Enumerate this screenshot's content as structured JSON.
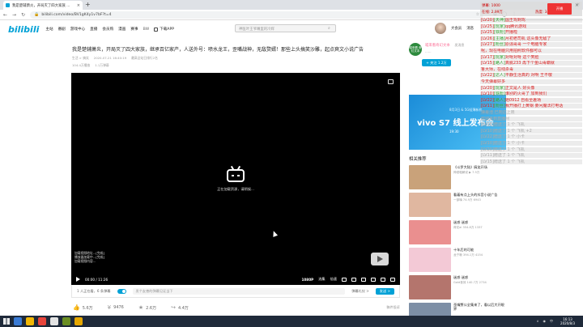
{
  "browser": {
    "tab_title": "我是楚辅萧炎，开局灭了四大家族 ...",
    "tab_close": "×",
    "new_tab": "+",
    "window_controls": [
      "—",
      "□",
      "×"
    ],
    "url": "bilibili.com/video/BV1gK4y1v7bF?t=4",
    "nav_back": "←",
    "nav_forward": "→",
    "nav_reload": "↻"
  },
  "site": {
    "logo": "bilibili",
    "nav": [
      "主站",
      "番剧",
      "游戏中心",
      "直播",
      "会员购",
      "漫画",
      "赛事"
    ],
    "bw": "BW",
    "download": "下载APP",
    "search_placeholder": "神医叶王爷嘴里的冷辉",
    "user_label": "大会员",
    "message_label": "消息"
  },
  "video": {
    "title": "我是楚辅萧炎，开局灭了四大家族，继承百亿家产，人送外号：喷水龙王，歪嘴战神，无敌赘婿！那些上头搞笑沙雕，起点爽文小说广告",
    "meta": [
      "生活 > 搞笑",
      "2020-07-21 16:40:19",
      "最高全站日排行2名"
    ],
    "stats": [
      "104.4万播放",
      "1.1万弹幕"
    ],
    "loading_text": "正在加载资源，请稍候...",
    "logs": [
      "加载视频地址...[完成]",
      "播放器加载中...[完成]",
      "加载视频内容..."
    ],
    "time": "00:00 / 11:26",
    "quality": "1080P",
    "controls": [
      "选集",
      "倍速"
    ],
    "viewers": "1 人正在看，6 条弹幕",
    "danmaku_placeholder": "发个友善的弹幕见证当下",
    "danmaku_rule": "弹幕礼仪 >",
    "danmaku_send": "发送 >",
    "actions": [
      {
        "icon": "👍",
        "count": "5.6万"
      },
      {
        "icon": "¥",
        "count": "9476"
      },
      {
        "icon": "★",
        "count": "2.6万"
      },
      {
        "icon": "↪",
        "count": "4.4万"
      }
    ],
    "report": "稿件投诉"
  },
  "uploader": {
    "name": "喵来看奇幻文本",
    "avatar_text": "喵来看 奇幻文本",
    "message": "发消息",
    "desc": "……",
    "follow": "+ 关注 1.2万"
  },
  "ad": {
    "headline": "vivo S7 线上发布会",
    "sub": "8月3日 & 5G轻薄新机",
    "time": "19:30"
  },
  "related": {
    "title": "相关推荐",
    "items": [
      {
        "title": "《斗罗大陆》搞笑开场",
        "sub": "神烦喵解说\n▶ 7.5万",
        "color": "#c9a27a"
      },
      {
        "title": "看着有点上头的抖音小说广告",
        "sub": "一部嗨\n74.9万  6943",
        "color": "#e0b7a0"
      },
      {
        "title": "迷惑 迷惑",
        "sub": "荷花ai\n354.8万  1337",
        "color": "#ea8f8f"
      },
      {
        "title": "十年后的可能",
        "sub": "龙宁哦\n394.1万  4154",
        "color": "#f3c9d6"
      },
      {
        "title": "迷惑 迷惑",
        "sub": "Gold音效\n140.7万  2734",
        "color": "#b4756d"
      },
      {
        "title": "歪嘴赘公全集来了，看以后大开眼界",
        "sub": "",
        "color": "#7d8fa6"
      }
    ]
  },
  "danmaku_panel": {
    "line1": "弹幕: 1000",
    "line2": "在线: 2.99万",
    "counter": "热度: 341",
    "red_button": "开播",
    "close": "×",
    "lines": [
      {
        "lvl": "[LV20]",
        "name": "[天神]",
        "text": "国王驾到驾",
        "style": "normal"
      },
      {
        "lvl": "[LV25]",
        "name": "[玩家]",
        "text": "qq腾讯游戏",
        "style": "normal"
      },
      {
        "lvl": "[LV25]",
        "name": "[铁粉]",
        "text": "开播啦",
        "style": "normal"
      },
      {
        "lvl": "[LV26]",
        "name": "[主播]",
        "text": "月初老司机 这头像无敌了",
        "style": "normal"
      },
      {
        "lvl": "[LV27]",
        "name": "[粉丝]",
        "text": "原谅哥哥 一个电脑专家",
        "style": "normal"
      },
      {
        "lvl": "",
        "name": "",
        "text": "呢，现在电脑只用拍照软件都可以",
        "style": "normal"
      },
      {
        "lvl": "[LV17]",
        "name": "[玩家]",
        "text": "对呀对呀 这个笑脸",
        "style": "normal"
      },
      {
        "lvl": "[LV15]",
        "name": "[路人]",
        "text": "真腻233 再下个金山毒霸就",
        "style": "normal"
      },
      {
        "lvl": "",
        "name": "",
        "text": "鲁大师，在线杀毒",
        "style": "normal"
      },
      {
        "lvl": "[LV22]",
        "name": "[达人]",
        "text": "平静生活真的 对啊 王不敬",
        "style": "normal"
      },
      {
        "lvl": "",
        "name": "",
        "text": "今天弹幕好多",
        "style": "normal"
      },
      {
        "lvl": "[LV20]",
        "name": "[玩家]",
        "text": "正文是人 好头像",
        "style": "normal"
      },
      {
        "lvl": "[LV10]",
        "name": "[铁粉]",
        "text": "谁别的火哥了 加到我们",
        "style": "normal"
      },
      {
        "lvl": "[LV22]",
        "name": "[路人]",
        "text": "她0912 自看全差场",
        "style": "normal"
      },
      {
        "lvl": "[LV11]",
        "name": "[粉丝]",
        "text": "我开播打上黄钢 要问魔法打电话",
        "style": "normal"
      },
      {
        "lvl": "",
        "name": "",
        "text": "弹幕池 已到达上限",
        "style": "grey"
      },
      {
        "lvl": "",
        "name": "",
        "text": "欢迎来到直播间",
        "style": "grey"
      },
      {
        "lvl": "[LV15]",
        "name": "",
        "text": "赠送了 1 个 飞机",
        "style": "grey"
      },
      {
        "lvl": "[LV10]",
        "name": "",
        "text": "赠送了 1 个 飞机 +2",
        "style": "grey"
      },
      {
        "lvl": "[LV22]",
        "name": "",
        "text": "赠送了 1 个 小卡",
        "style": "grey"
      },
      {
        "lvl": "[LV10]",
        "name": "",
        "text": "赠送了 1 个 小卡",
        "style": "grey"
      },
      {
        "lvl": "[LV20]",
        "name": "",
        "text": "赠送了 1 个 飞机",
        "style": "grey"
      },
      {
        "lvl": "[LV11]",
        "name": "",
        "text": "赠送了 1 个 飞机",
        "style": "grey"
      },
      {
        "lvl": "[LV15]",
        "name": "",
        "text": "赠送了 1 个 飞机",
        "style": "grey"
      }
    ]
  },
  "taskbar": {
    "time": "16:13",
    "date": "2020/8/3",
    "tray": [
      "∧",
      "◉",
      "中"
    ]
  }
}
